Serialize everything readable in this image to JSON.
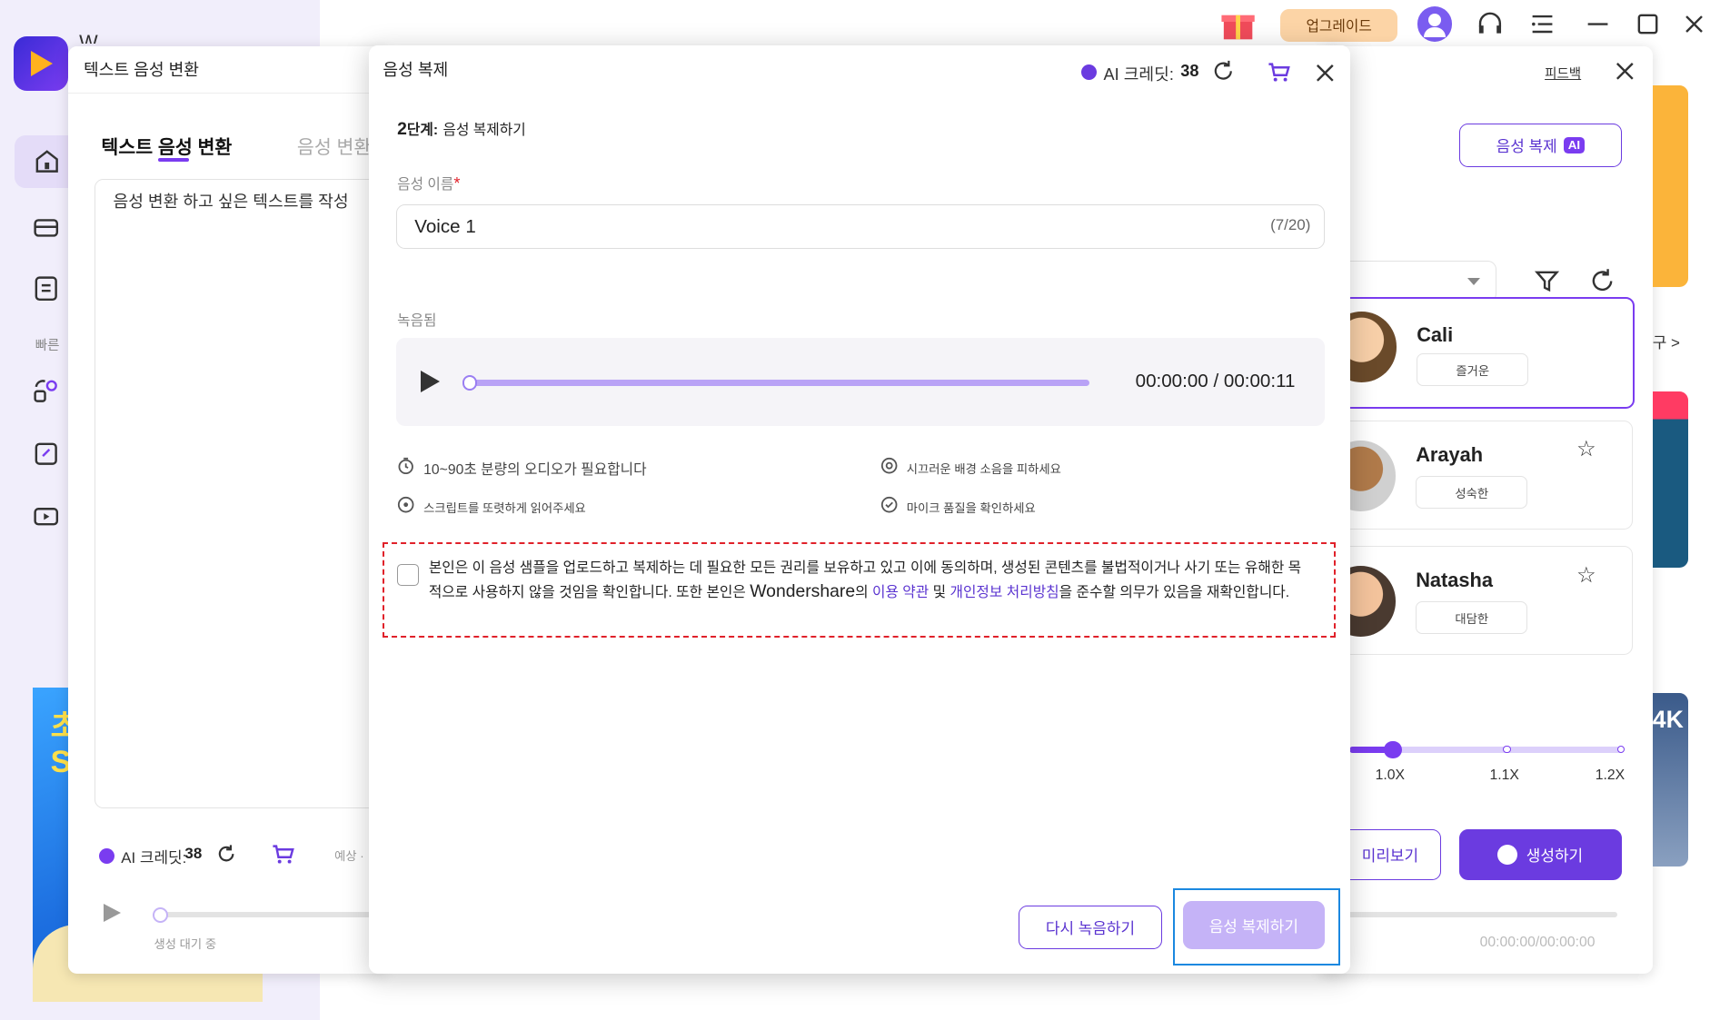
{
  "app": {
    "title_partial": "W...",
    "upgrade_label": "업그레이드",
    "sidebar_quick_label": "빠른"
  },
  "tts_panel": {
    "window_title": "텍스트 음성 변환",
    "tabs": [
      "텍스트 음성 변환",
      "음성 변환"
    ],
    "editor_placeholder": "음성 변환 하고 싶은 텍스트를 작성",
    "credits_label": "AI 크레딧:",
    "credits_value": "38",
    "estimate_label": "예상 ·",
    "status": "생성 대기 중"
  },
  "modal": {
    "title": "음성 복제",
    "credits_label": "AI 크레딧:",
    "credits_value": "38",
    "step_number": "2",
    "step_title": "단계:",
    "step_desc": "음성 복제하기",
    "name_label": "음성 이름",
    "required_mark": "*",
    "name_value": "Voice 1",
    "name_counter": "(7/20)",
    "recorded_label": "녹음됨",
    "time_display": "00:00:00 / 00:00:11",
    "progress": 0,
    "tips": [
      "10~90초 분량의 오디오가 필요합니다",
      "시끄러운 배경 소음을 피하세요",
      "스크립트를 또렷하게 읽어주세요",
      "마이크 품질을 확인하세요"
    ],
    "agreement": {
      "checked": false,
      "text1": "본인은 이 음성 샘플을 업로드하고 복제하는 데 필요한 모든 권리를 보유하고 있고 이에 동의하며, 생성된 콘텐츠를 불법적이거나 사기 또는 유해한 목적으로 사용하지 않을 것임을 확인합니다. 또한 본인은 ",
      "brand": "Wondershare",
      "text2": "의 ",
      "link_terms": "이용 약관",
      "text3": " 및 ",
      "link_privacy": "개인정보 처리방침",
      "text4": "을 준수할 의무가 있음을 재확인합니다."
    },
    "rerecord_label": "다시 녹음하기",
    "clone_label": "음성 복제하기"
  },
  "right_panel": {
    "feedback_label": "피드백",
    "clone_button_label": "음성 복제",
    "ai_badge": "AI",
    "more_label": "구 >",
    "voices": [
      {
        "name": "Cali",
        "tag": "즐거운"
      },
      {
        "name": "Arayah",
        "tag": "성숙한"
      },
      {
        "name": "Natasha",
        "tag": "대담한"
      }
    ],
    "speed_ticks": [
      "1.0X",
      "1.1X",
      "1.2X"
    ],
    "speed_value": 1.0,
    "preview_label": "미리보기",
    "generate_label": "생성하기",
    "time_display": "00:00:00/00:00:00",
    "promo_partial": "4K"
  },
  "colors": {
    "accent": "#6b3be0",
    "accent_light": "#c5b3f7",
    "link": "#5a33d0",
    "required": "#e0212a"
  }
}
